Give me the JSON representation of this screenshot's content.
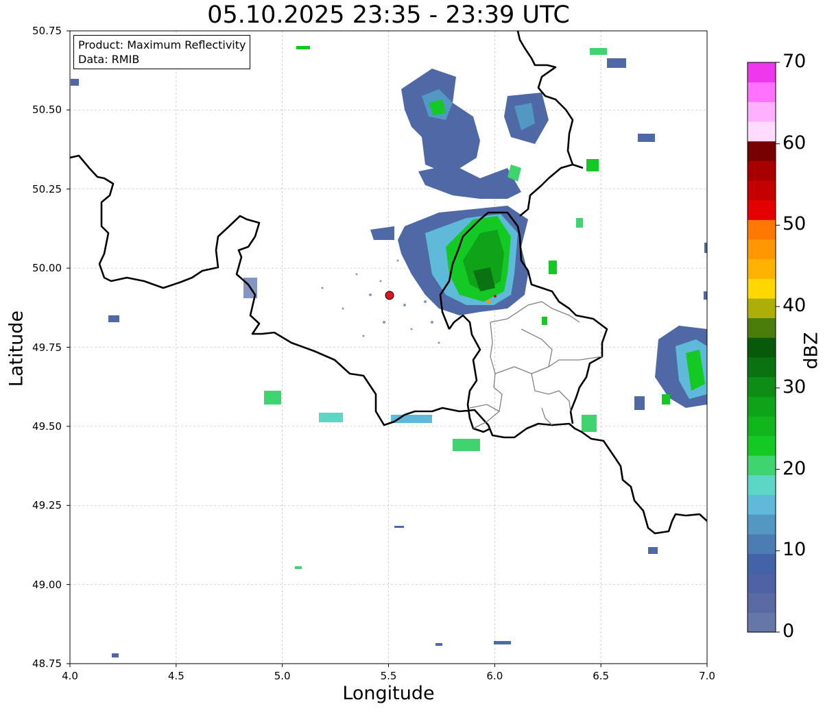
{
  "title": "05.10.2025 23:35 - 23:39 UTC",
  "info": {
    "product": "Product: Maximum Reflectivity",
    "source": "Data: RMIB"
  },
  "axes": {
    "xlabel": "Longitude",
    "ylabel": "Latitude",
    "xlim": [
      4.0,
      7.0
    ],
    "ylim": [
      48.75,
      50.75
    ],
    "xticks": [
      "4.0",
      "4.5",
      "5.0",
      "5.5",
      "6.0",
      "6.5",
      "7.0"
    ],
    "yticks": [
      "50.75",
      "50.50",
      "50.25",
      "50.00",
      "49.75",
      "49.50",
      "49.25",
      "49.00",
      "48.75"
    ],
    "grid": true
  },
  "colorbar": {
    "label": "dBZ",
    "range": [
      0,
      70
    ],
    "ticks": [
      "70",
      "60",
      "50",
      "40",
      "30",
      "20",
      "10",
      "0"
    ],
    "colors": [
      "#6577a7",
      "#5a6aa3",
      "#4f62a3",
      "#4462a8",
      "#4b7db3",
      "#5398c3",
      "#5fbad9",
      "#5ed6c6",
      "#3fd46f",
      "#14c924",
      "#10b41b",
      "#0fa319",
      "#0d8c16",
      "#0a7211",
      "#065a0a",
      "#4a7c0a",
      "#adaf09",
      "#ffd800",
      "#ffb200",
      "#ff9800",
      "#ff7800",
      "#e50000",
      "#c40000",
      "#a80000",
      "#770000",
      "#ffdcff",
      "#ffb0ff",
      "#ff72ff",
      "#ee38ee"
    ]
  },
  "radar_site": {
    "lon": 5.505,
    "lat": 49.914,
    "color": "#e0141e"
  }
}
